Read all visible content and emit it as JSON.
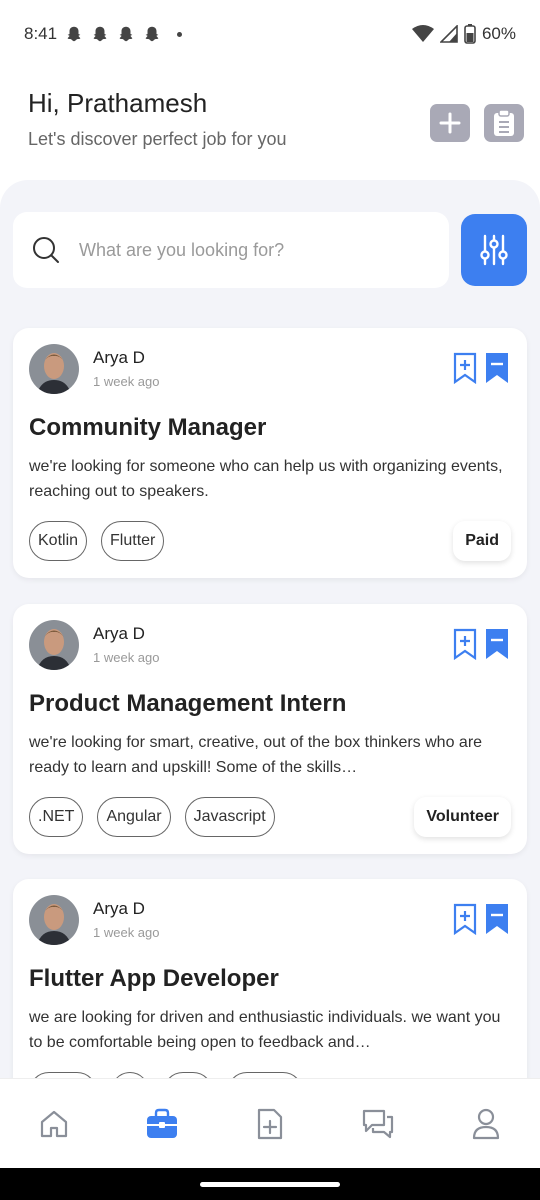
{
  "status_bar": {
    "time": "8:41",
    "battery": "60%"
  },
  "header": {
    "greeting": "Hi, Prathamesh",
    "subtitle": "Let's discover perfect job for you"
  },
  "search": {
    "placeholder": "What are you looking for?"
  },
  "colors": {
    "accent": "#3d7ff0",
    "muted_button": "#a9a9b6"
  },
  "jobs": [
    {
      "author": "Arya D",
      "posted": "1 week ago",
      "title": "Community Manager",
      "description": "we're looking for someone who can help us with organizing events, reaching out to speakers.",
      "tags": [
        "Kotlin",
        "Flutter"
      ],
      "pay": "Paid"
    },
    {
      "author": "Arya D",
      "posted": "1 week ago",
      "title": "Product Management Intern",
      "description": "we're looking for smart, creative, out of the box thinkers who are ready to learn and upskill! Some of the skills…",
      "tags": [
        ".NET",
        "Angular",
        "Javascript"
      ],
      "pay": "Volunteer"
    },
    {
      "author": "Arya D",
      "posted": "1 week ago",
      "title": "Flutter App Developer",
      "description": "we are looking for driven and enthusiastic individuals. we want you to be comfortable being open to feedback and…",
      "tags": [],
      "pay": ""
    }
  ],
  "nav": {
    "items": [
      "home-icon",
      "briefcase-icon",
      "add-document-icon",
      "chat-icon",
      "profile-icon"
    ],
    "active": "briefcase-icon"
  }
}
